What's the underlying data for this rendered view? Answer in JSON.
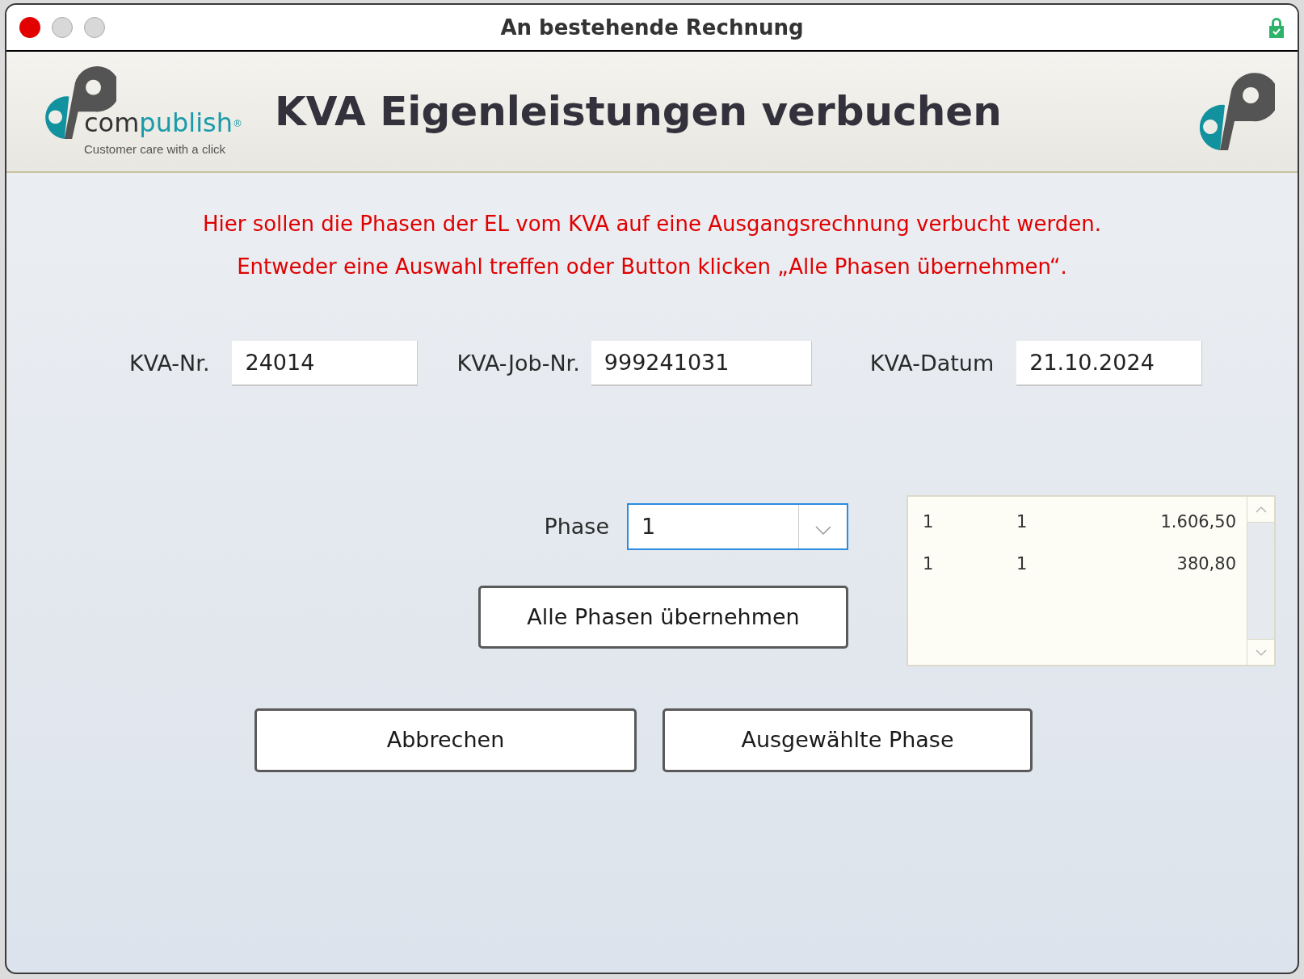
{
  "window": {
    "title": "An bestehende Rechnung"
  },
  "header": {
    "logo": {
      "wordmark_dark": "com",
      "wordmark_accent": "publish",
      "registered": "®",
      "tagline": "Customer care with a click"
    },
    "title": "KVA Eigenleistungen verbuchen"
  },
  "instructions": [
    "Hier sollen die Phasen der EL vom KVA auf eine Ausgangsrechnung verbucht werden.",
    "Entweder eine Auswahl treffen oder Button klicken „Alle Phasen übernehmen“."
  ],
  "fields": [
    {
      "label": "KVA-Nr.",
      "value": "24014"
    },
    {
      "label": "KVA-Job-Nr.",
      "value": "999241031"
    },
    {
      "label": "KVA-Datum",
      "value": "21.10.2024"
    }
  ],
  "phase": {
    "label": "Phase",
    "value": "1",
    "focused": true
  },
  "all_phases_button": "Alle Phasen übernehmen",
  "list": {
    "rows": [
      {
        "column_1": "1",
        "column_2": "1",
        "column_3": "1.606,50"
      },
      {
        "column_1": "1",
        "column_2": "1",
        "column_3": "380,80"
      }
    ]
  },
  "buttons": [
    "Abbrechen",
    "Ausgewählte Phase"
  ]
}
